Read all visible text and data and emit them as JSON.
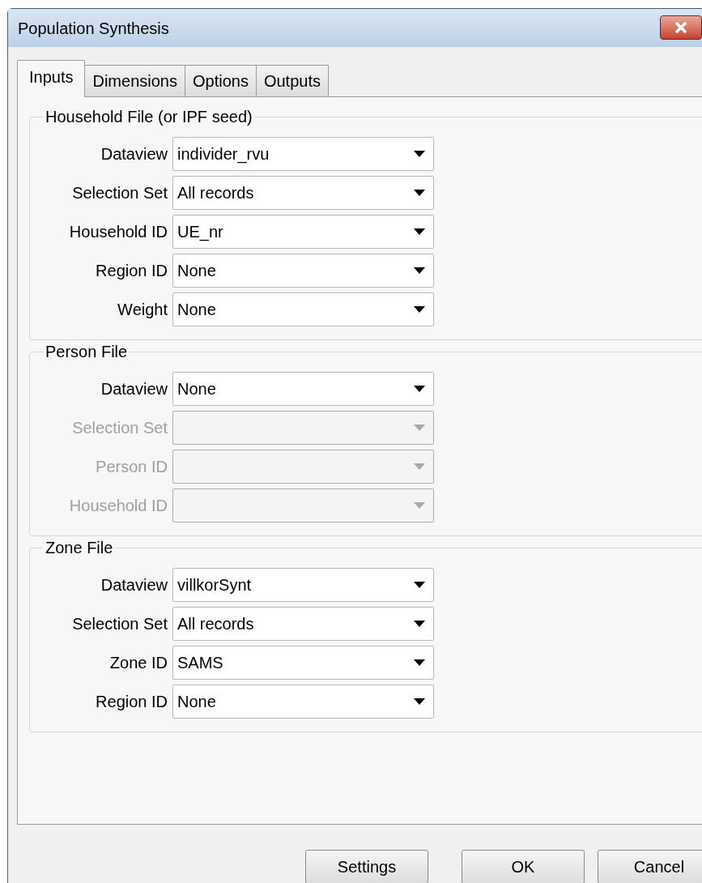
{
  "window": {
    "title": "Population Synthesis"
  },
  "tabs": [
    {
      "label": "Inputs",
      "selected": true
    },
    {
      "label": "Dimensions",
      "selected": false
    },
    {
      "label": "Options",
      "selected": false
    },
    {
      "label": "Outputs",
      "selected": false
    }
  ],
  "groups": [
    {
      "title": "Household File (or IPF seed)",
      "fields": [
        {
          "label": "Dataview",
          "value": "individer_rvu",
          "disabled": false
        },
        {
          "label": "Selection Set",
          "value": "All records",
          "disabled": false
        },
        {
          "label": "Household ID",
          "value": "UE_nr",
          "disabled": false
        },
        {
          "label": "Region ID",
          "value": "None",
          "disabled": false
        },
        {
          "label": "Weight",
          "value": "None",
          "disabled": false
        }
      ]
    },
    {
      "title": "Person File",
      "fields": [
        {
          "label": "Dataview",
          "value": "None",
          "disabled": false
        },
        {
          "label": "Selection Set",
          "disabled": true
        },
        {
          "label": "Person ID",
          "disabled": true
        },
        {
          "label": "Household ID",
          "disabled": true
        }
      ]
    },
    {
      "title": "Zone File",
      "fields": [
        {
          "label": "Dataview",
          "value": "villkorSynt",
          "disabled": false
        },
        {
          "label": "Selection Set",
          "value": "All records",
          "disabled": false
        },
        {
          "label": "Zone ID",
          "value": "SAMS",
          "disabled": false
        },
        {
          "label": "Region ID",
          "value": "None",
          "disabled": false
        }
      ]
    }
  ],
  "buttons": [
    "Settings",
    "OK",
    "Cancel"
  ]
}
